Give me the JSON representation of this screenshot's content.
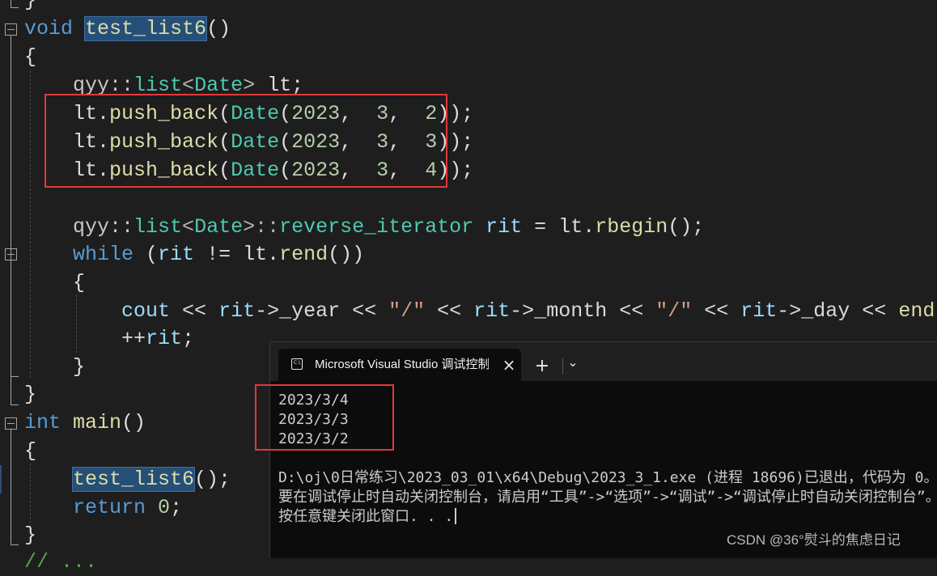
{
  "code": {
    "prev_line_tail": "}",
    "fn1": {
      "kw": "void",
      "name": "test_list6",
      "rest": "()"
    },
    "open_brace": "{",
    "decl": {
      "ns": "qyy::",
      "list": "list",
      "lt": "<",
      "type": "Date",
      "gt": ">",
      "var": " lt;"
    },
    "push_backs": [
      {
        "obj": "lt",
        "dot": ".",
        "fn": "push_back",
        "p1": "(",
        "ty": "Date",
        "p2": "(",
        "y": "2023",
        "c1": ",  ",
        "m": "3",
        "c2": ",  ",
        "d": "2",
        "end": "));"
      },
      {
        "obj": "lt",
        "dot": ".",
        "fn": "push_back",
        "p1": "(",
        "ty": "Date",
        "p2": "(",
        "y": "2023",
        "c1": ",  ",
        "m": "3",
        "c2": ",  ",
        "d": "3",
        "end": "));"
      },
      {
        "obj": "lt",
        "dot": ".",
        "fn": "push_back",
        "p1": "(",
        "ty": "Date",
        "p2": "(",
        "y": "2023",
        "c1": ",  ",
        "m": "3",
        "c2": ",  ",
        "d": "4",
        "end": "));"
      }
    ],
    "iter_decl": {
      "ns": "qyy::",
      "list": "list",
      "lt": "<",
      "type": "Date",
      "gt": ">::",
      "iter": "reverse_iterator",
      "var": " rit",
      "eq": " = ",
      "obj": "lt",
      "dot": ".",
      "fn": "rbegin",
      "end": "();"
    },
    "while_line": {
      "kw": "while",
      "sp": " (",
      "rit": "rit",
      "neq": " != ",
      "obj": "lt",
      "dot": ".",
      "fn": "rend",
      "end": "())"
    },
    "inner_open": "{",
    "cout_line": {
      "cout": "cout",
      "op1": " << ",
      "rit1": "rit",
      "arrow1": "->",
      "year": "_year",
      "op2": " << ",
      "s1": "\"/\"",
      "op3": " << ",
      "rit2": "rit",
      "arrow2": "->",
      "month": "_month",
      "op4": " << ",
      "s2": "\"/\"",
      "op5": " << ",
      "rit3": "rit",
      "arrow3": "->",
      "day": "_day",
      "op6": " << ",
      "endl": "endl",
      "semi": ";"
    },
    "incr_line": {
      "op": "++",
      "rit": "rit",
      "semi": ";"
    },
    "inner_close": "}",
    "fn1_close": "}",
    "fn2": {
      "kw": "int",
      "name": " main",
      "rest": "()"
    },
    "open_brace2": "{",
    "call": {
      "fn": "test_list6",
      "rest": "();"
    },
    "ret": {
      "kw": "return",
      "sp": " ",
      "val": "0",
      "semi": ";"
    },
    "fn2_close": "}",
    "next_line": "// ..."
  },
  "console": {
    "tab_title": "Microsoft Visual Studio 调试控制台",
    "tab_icon": "C:\\",
    "close_icon": "×",
    "new_tab_icon": "+",
    "dropdown_icon": "⌄",
    "output_lines": [
      "2023/3/4",
      "2023/3/3",
      "2023/3/2"
    ],
    "exit_line": "D:\\oj\\0日常练习\\2023_03_01\\x64\\Debug\\2023_3_1.exe (进程 18696)已退出，代码为 0。",
    "hint_line": "要在调试停止时自动关闭控制台，请启用“工具”->“选项”->“调试”->“调试停止时自动关闭控制台”。",
    "prompt_line": "按任意键关闭此窗口. . ."
  },
  "watermark": "CSDN @36°熨斗的焦虑日记",
  "colors": {
    "keyword": "#569cd6",
    "type": "#4ec9b0",
    "function": "#dcdcaa",
    "identifier": "#9cdcfe",
    "number": "#b5cea8",
    "string": "#d69d85",
    "annotation": "#e0393b"
  }
}
